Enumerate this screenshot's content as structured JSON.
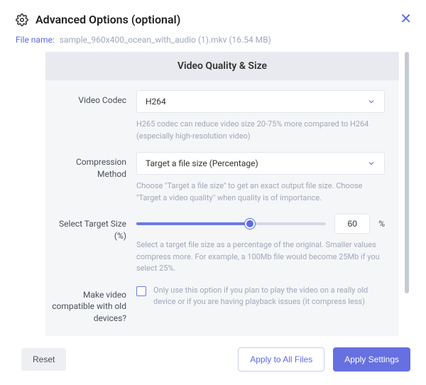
{
  "header": {
    "title": "Advanced Options (optional)"
  },
  "file": {
    "label": "File name:",
    "name": "sample_960x400_ocean_with_audio (1).mkv (16.54 MB)"
  },
  "card": {
    "title": "Video Quality & Size",
    "codec": {
      "label": "Video Codec",
      "value": "H264",
      "help": "H265 codec can reduce video size 20-75% more compared to H264 (especially high-resolution video)"
    },
    "method": {
      "label": "Compression Method",
      "value": "Target a file size (Percentage)",
      "help": "Choose \"Target a file size\" to get an exact output file size. Choose \"Target a video quality\" when quality is of importance."
    },
    "target": {
      "label": "Select Target Size (%)",
      "value": "60",
      "percent_sign": "%",
      "help": "Select a target file size as a percentage of the original. Smaller values compress more. For example, a 100Mb file would become 25Mb if you select 25%."
    },
    "compat": {
      "label": "Make video compatible with old devices?",
      "help": "Only use this option if you plan to play the video on a really old device or if you are having playback issues (it compress less)"
    }
  },
  "footer": {
    "reset": "Reset",
    "apply_all": "Apply to All Files",
    "apply": "Apply Settings"
  }
}
